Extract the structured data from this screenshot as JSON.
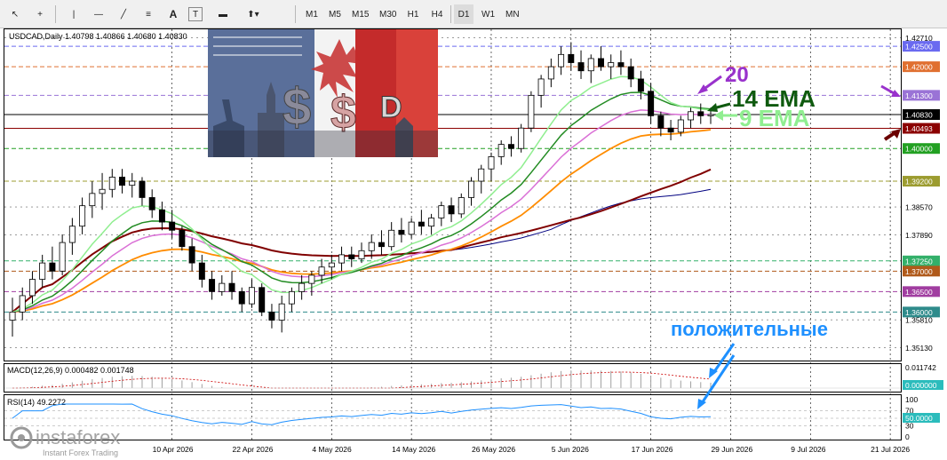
{
  "toolbar": {
    "tools": [
      {
        "name": "cursor-icon",
        "glyph": "↖"
      },
      {
        "name": "crosshair-icon",
        "glyph": "+"
      },
      {
        "name": "vertical-line-icon",
        "glyph": "|"
      },
      {
        "name": "horizontal-line-icon",
        "glyph": "—"
      },
      {
        "name": "trendline-icon",
        "glyph": "╱"
      },
      {
        "name": "fibonacci-icon",
        "glyph": "≡"
      },
      {
        "name": "text-icon",
        "glyph": "A"
      },
      {
        "name": "text-label-icon",
        "glyph": "T"
      },
      {
        "name": "shapes-icon",
        "glyph": "▬"
      },
      {
        "name": "arrows-icon",
        "glyph": "⬆▾"
      }
    ],
    "timeframes": [
      "M1",
      "M5",
      "M15",
      "M30",
      "H1",
      "H4",
      "D1",
      "W1",
      "MN"
    ]
  },
  "symbol_info": "USDCAD,Daily  1.40798 1.40866 1.40680 1.40830",
  "macd_label": "MACD(12,26,9) 0.000482 0.001748",
  "rsi_label": "RSI(14) 49.2272",
  "annotations": {
    "ema20": "20",
    "ema14": "14 EMA",
    "ema9": "9 EMA",
    "positive": "положительные"
  },
  "watermark": {
    "brand": "instaforex",
    "tagline": "Instant Forex Trading"
  },
  "colors": {
    "bull": "#ffffff",
    "bear": "#000000",
    "ema9": "#90ee90",
    "ema14": "#228b22",
    "ema20": "#da70d6",
    "ma_orange": "#ff8c00",
    "ma_maroon": "#800000",
    "ma_navy": "#000080",
    "annotation_blue": "#1e90ff",
    "annotation_purple": "#9932cc"
  },
  "chart_data": {
    "type": "candlestick",
    "symbol": "USDCAD",
    "timeframe": "Daily",
    "ylim": [
      1.349,
      1.4285
    ],
    "price_ticks": [
      1.4271,
      1.425,
      1.42,
      1.413,
      1.4083,
      1.40493,
      1.4,
      1.392,
      1.3857,
      1.3789,
      1.3725,
      1.37,
      1.365,
      1.36,
      1.3581,
      1.3513
    ],
    "price_tick_labels": [
      "1.42710",
      "1.42500",
      "1.42000",
      "1.41300",
      "1.40830",
      "1.40493",
      "1.40000",
      "1.39200",
      "1.38570",
      "1.37890",
      "1.37250",
      "1.37000",
      "1.36500",
      "1.36000",
      "1.35810",
      "1.35130"
    ],
    "highlighted_levels": [
      {
        "label": "1.42500",
        "value": 1.425,
        "color": "#6a6af0"
      },
      {
        "label": "1.42000",
        "value": 1.42,
        "color": "#e07030"
      },
      {
        "label": "1.41300",
        "value": 1.413,
        "color": "#9a73d6"
      },
      {
        "label": "1.40830",
        "value": 1.4083,
        "color": "#000000"
      },
      {
        "label": "1.40493",
        "value": 1.40493,
        "color": "#8b0000"
      },
      {
        "label": "1.40000",
        "value": 1.4,
        "color": "#22a022"
      },
      {
        "label": "1.39200",
        "value": 1.392,
        "color": "#9c9c30"
      },
      {
        "label": "1.37250",
        "value": 1.3725,
        "color": "#33b06a"
      },
      {
        "label": "1.37000",
        "value": 1.37,
        "color": "#b05a1a"
      },
      {
        "label": "1.36500",
        "value": 1.365,
        "color": "#a03da0"
      },
      {
        "label": "1.36000",
        "value": 1.36,
        "color": "#2e8b8b"
      }
    ],
    "x_labels": [
      "10 Apr 2026",
      "22 Apr 2026",
      "4 May 2026",
      "14 May 2026",
      "26 May 2026",
      "5 Jun 2026",
      "17 Jun 2026",
      "29 Jun 2026",
      "9 Jul 2026",
      "21 Jul 2026"
    ],
    "x_label_bars": [
      16,
      24,
      32,
      40,
      48,
      56,
      64,
      72,
      80,
      88
    ],
    "candles_ohlc": [
      [
        1.358,
        1.3635,
        1.354,
        1.36
      ],
      [
        1.36,
        1.366,
        1.358,
        1.364
      ],
      [
        1.364,
        1.37,
        1.362,
        1.368
      ],
      [
        1.368,
        1.374,
        1.366,
        1.372
      ],
      [
        1.372,
        1.376,
        1.368,
        1.37
      ],
      [
        1.37,
        1.379,
        1.369,
        1.377
      ],
      [
        1.377,
        1.383,
        1.374,
        1.381
      ],
      [
        1.381,
        1.388,
        1.379,
        1.386
      ],
      [
        1.386,
        1.392,
        1.383,
        1.389
      ],
      [
        1.389,
        1.394,
        1.385,
        1.39
      ],
      [
        1.39,
        1.395,
        1.388,
        1.393
      ],
      [
        1.393,
        1.395,
        1.389,
        1.391
      ],
      [
        1.391,
        1.394,
        1.388,
        1.392
      ],
      [
        1.392,
        1.393,
        1.386,
        1.388
      ],
      [
        1.388,
        1.39,
        1.383,
        1.385
      ],
      [
        1.385,
        1.387,
        1.38,
        1.382
      ],
      [
        1.382,
        1.385,
        1.378,
        1.38
      ],
      [
        1.38,
        1.381,
        1.375,
        1.376
      ],
      [
        1.376,
        1.378,
        1.37,
        1.372
      ],
      [
        1.372,
        1.374,
        1.366,
        1.368
      ],
      [
        1.368,
        1.37,
        1.363,
        1.365
      ],
      [
        1.365,
        1.369,
        1.364,
        1.367
      ],
      [
        1.367,
        1.37,
        1.363,
        1.365
      ],
      [
        1.365,
        1.366,
        1.36,
        1.362
      ],
      [
        1.362,
        1.368,
        1.361,
        1.366
      ],
      [
        1.366,
        1.367,
        1.359,
        1.36
      ],
      [
        1.36,
        1.362,
        1.356,
        1.358
      ],
      [
        1.358,
        1.364,
        1.355,
        1.362
      ],
      [
        1.362,
        1.366,
        1.36,
        1.365
      ],
      [
        1.365,
        1.369,
        1.363,
        1.367
      ],
      [
        1.367,
        1.37,
        1.364,
        1.369
      ],
      [
        1.369,
        1.373,
        1.367,
        1.371
      ],
      [
        1.371,
        1.374,
        1.368,
        1.372
      ],
      [
        1.372,
        1.376,
        1.37,
        1.374
      ],
      [
        1.374,
        1.376,
        1.371,
        1.373
      ],
      [
        1.373,
        1.377,
        1.372,
        1.375
      ],
      [
        1.375,
        1.379,
        1.373,
        1.377
      ],
      [
        1.377,
        1.38,
        1.374,
        1.376
      ],
      [
        1.376,
        1.382,
        1.375,
        1.38
      ],
      [
        1.38,
        1.383,
        1.377,
        1.379
      ],
      [
        1.379,
        1.383,
        1.378,
        1.382
      ],
      [
        1.382,
        1.385,
        1.379,
        1.381
      ],
      [
        1.381,
        1.384,
        1.379,
        1.383
      ],
      [
        1.383,
        1.387,
        1.381,
        1.386
      ],
      [
        1.386,
        1.388,
        1.382,
        1.384
      ],
      [
        1.384,
        1.389,
        1.383,
        1.388
      ],
      [
        1.388,
        1.393,
        1.386,
        1.392
      ],
      [
        1.392,
        1.396,
        1.389,
        1.395
      ],
      [
        1.395,
        1.399,
        1.392,
        1.398
      ],
      [
        1.398,
        1.402,
        1.396,
        1.401
      ],
      [
        1.401,
        1.403,
        1.398,
        1.4
      ],
      [
        1.4,
        1.406,
        1.399,
        1.405
      ],
      [
        1.405,
        1.414,
        1.404,
        1.413
      ],
      [
        1.413,
        1.418,
        1.41,
        1.417
      ],
      [
        1.417,
        1.422,
        1.415,
        1.42
      ],
      [
        1.42,
        1.425,
        1.418,
        1.423
      ],
      [
        1.423,
        1.426,
        1.419,
        1.421
      ],
      [
        1.421,
        1.424,
        1.417,
        1.419
      ],
      [
        1.419,
        1.423,
        1.416,
        1.422
      ],
      [
        1.422,
        1.425,
        1.419,
        1.42
      ],
      [
        1.42,
        1.423,
        1.417,
        1.421
      ],
      [
        1.421,
        1.424,
        1.418,
        1.42
      ],
      [
        1.42,
        1.422,
        1.415,
        1.417
      ],
      [
        1.417,
        1.419,
        1.412,
        1.414
      ],
      [
        1.414,
        1.416,
        1.406,
        1.408
      ],
      [
        1.408,
        1.409,
        1.403,
        1.405
      ],
      [
        1.405,
        1.407,
        1.402,
        1.404
      ],
      [
        1.404,
        1.408,
        1.403,
        1.407
      ],
      [
        1.407,
        1.41,
        1.405,
        1.409
      ],
      [
        1.409,
        1.411,
        1.406,
        1.408
      ],
      [
        1.408,
        1.41,
        1.406,
        1.4083
      ]
    ],
    "moving_averages": [
      {
        "id": "ema9",
        "label": "9 EMA",
        "period": 9,
        "color": "#90ee90"
      },
      {
        "id": "ema14",
        "label": "14 EMA",
        "period": 14,
        "color": "#228b22"
      },
      {
        "id": "ema20",
        "label": "20",
        "period": 20,
        "color": "#da70d6"
      }
    ],
    "macd": {
      "params": "12,26,9",
      "main": 0.000482,
      "signal": 0.001748,
      "levels": [
        0.011742,
        0.0
      ]
    },
    "rsi": {
      "period": 14,
      "value": 49.2272,
      "levels": [
        100,
        70,
        50,
        30,
        0
      ],
      "level_labels": [
        "100",
        "70",
        "50.0000",
        "30",
        "0"
      ]
    }
  }
}
